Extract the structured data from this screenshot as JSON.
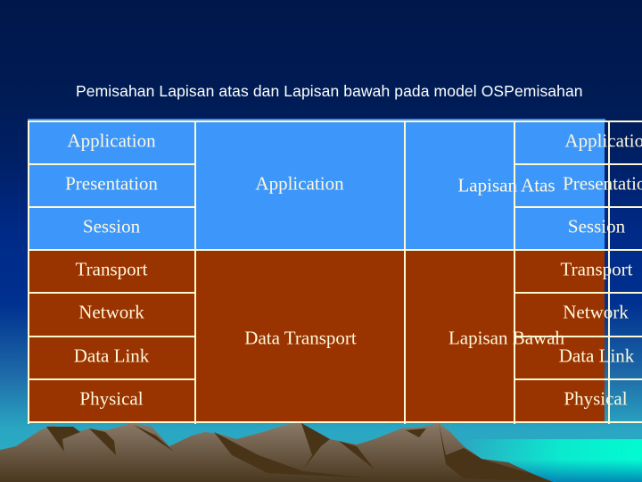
{
  "slide": {
    "title": "Pemisahan Lapisan atas dan Lapisan bawah pada model OSPemisahan"
  },
  "colors": {
    "upper_layers": "#3d97fb",
    "lower_layers": "#993300",
    "grid_lines": "#fff8d0",
    "text": "#fff8dc"
  },
  "table": {
    "left_column": {
      "rows": [
        "Application",
        "Presentation",
        "Session",
        "Transport",
        "Network",
        "Data Link",
        "Physical"
      ]
    },
    "middle_column": {
      "upper_label": "Application",
      "lower_label": "Data Transport"
    },
    "group_column": {
      "upper_label": "Lapisan Atas",
      "lower_label": "Lapisan Bawah"
    },
    "right_column": {
      "rows": [
        "Application",
        "Presentation",
        "Session",
        "Transport",
        "Network",
        "Data Link",
        "Physical"
      ]
    }
  }
}
